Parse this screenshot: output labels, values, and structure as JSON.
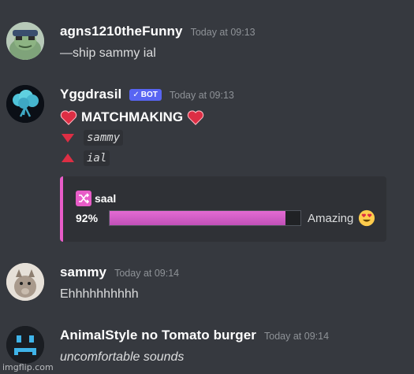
{
  "messages": [
    {
      "username": "agns1210theFunny",
      "timestamp": "Today at 09:13",
      "text": "—ship sammy ial"
    },
    {
      "username": "Yggdrasil",
      "bot_label": "BOT",
      "timestamp": "Today at 09:13",
      "matchmaking": {
        "title": "MATCHMAKING",
        "name_down": "sammy",
        "name_up": "ial"
      },
      "embed": {
        "title": "saal",
        "percent_label": "92%",
        "percent": 92,
        "verdict": "Amazing",
        "accent": "#e85cc8"
      }
    },
    {
      "username": "sammy",
      "timestamp": "Today at 09:14",
      "text": "Ehhhhhhhhhh"
    },
    {
      "username": "AnimalStyle no Tomato burger",
      "timestamp": "Today at 09:14",
      "text": "uncomfortable sounds"
    }
  ],
  "icons": {
    "heart": "heart-emoji",
    "down": "triangle-down",
    "up": "triangle-up",
    "shuffle": "shuffle-icon",
    "heart_eyes": "heart-eyes-emoji"
  },
  "watermark": "imgflip.com",
  "colors": {
    "background": "#36393f",
    "bot_tag": "#5865f2",
    "embed_accent": "#e85cc8"
  }
}
